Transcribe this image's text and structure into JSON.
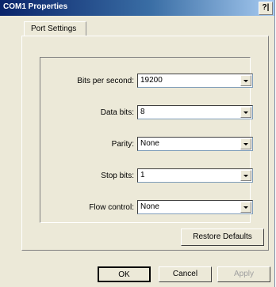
{
  "window": {
    "title": "COM1 Properties",
    "help": "?|"
  },
  "tabs": [
    {
      "label": "Port Settings"
    }
  ],
  "fields": [
    {
      "label": "Bits per second:",
      "value": "19200"
    },
    {
      "label": "Data bits:",
      "value": "8"
    },
    {
      "label": "Parity:",
      "value": "None"
    },
    {
      "label": "Stop bits:",
      "value": "1"
    },
    {
      "label": "Flow control:",
      "value": "None"
    }
  ],
  "buttons": {
    "restore": "Restore Defaults",
    "ok": "OK",
    "cancel": "Cancel",
    "apply": "Apply"
  }
}
